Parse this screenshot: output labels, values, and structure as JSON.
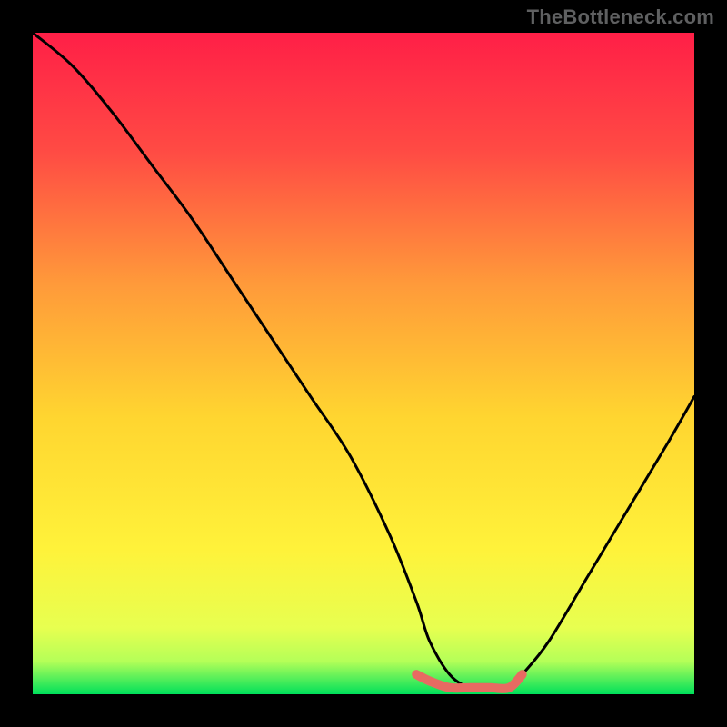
{
  "watermark": "TheBottleneck.com",
  "colors": {
    "background": "#000000",
    "gradient_top": "#ff1f47",
    "gradient_mid1": "#ff7a3a",
    "gradient_mid2": "#ffd叔30",
    "gradient_mid3": "#fff23a",
    "gradient_bottom": "#00e05b",
    "curve": "#000000",
    "highlight": "#e86a62",
    "watermark": "#5f6061"
  },
  "chart_data": {
    "type": "line",
    "title": "",
    "xlabel": "",
    "ylabel": "",
    "xlim": [
      0,
      100
    ],
    "ylim": [
      0,
      100
    ],
    "series": [
      {
        "name": "bottleneck-curve",
        "x": [
          0,
          6,
          12,
          18,
          24,
          30,
          36,
          42,
          48,
          54,
          58,
          60,
          63,
          66,
          69,
          72,
          74,
          78,
          84,
          90,
          96,
          100
        ],
        "values": [
          100,
          95,
          88,
          80,
          72,
          63,
          54,
          45,
          36,
          24,
          14,
          8,
          3,
          1,
          1,
          1,
          3,
          8,
          18,
          28,
          38,
          45
        ]
      },
      {
        "name": "highlight-range",
        "x": [
          58,
          60,
          63,
          66,
          69,
          72,
          74
        ],
        "values": [
          3,
          2,
          1,
          1,
          1,
          1,
          3
        ]
      }
    ],
    "annotations": []
  }
}
